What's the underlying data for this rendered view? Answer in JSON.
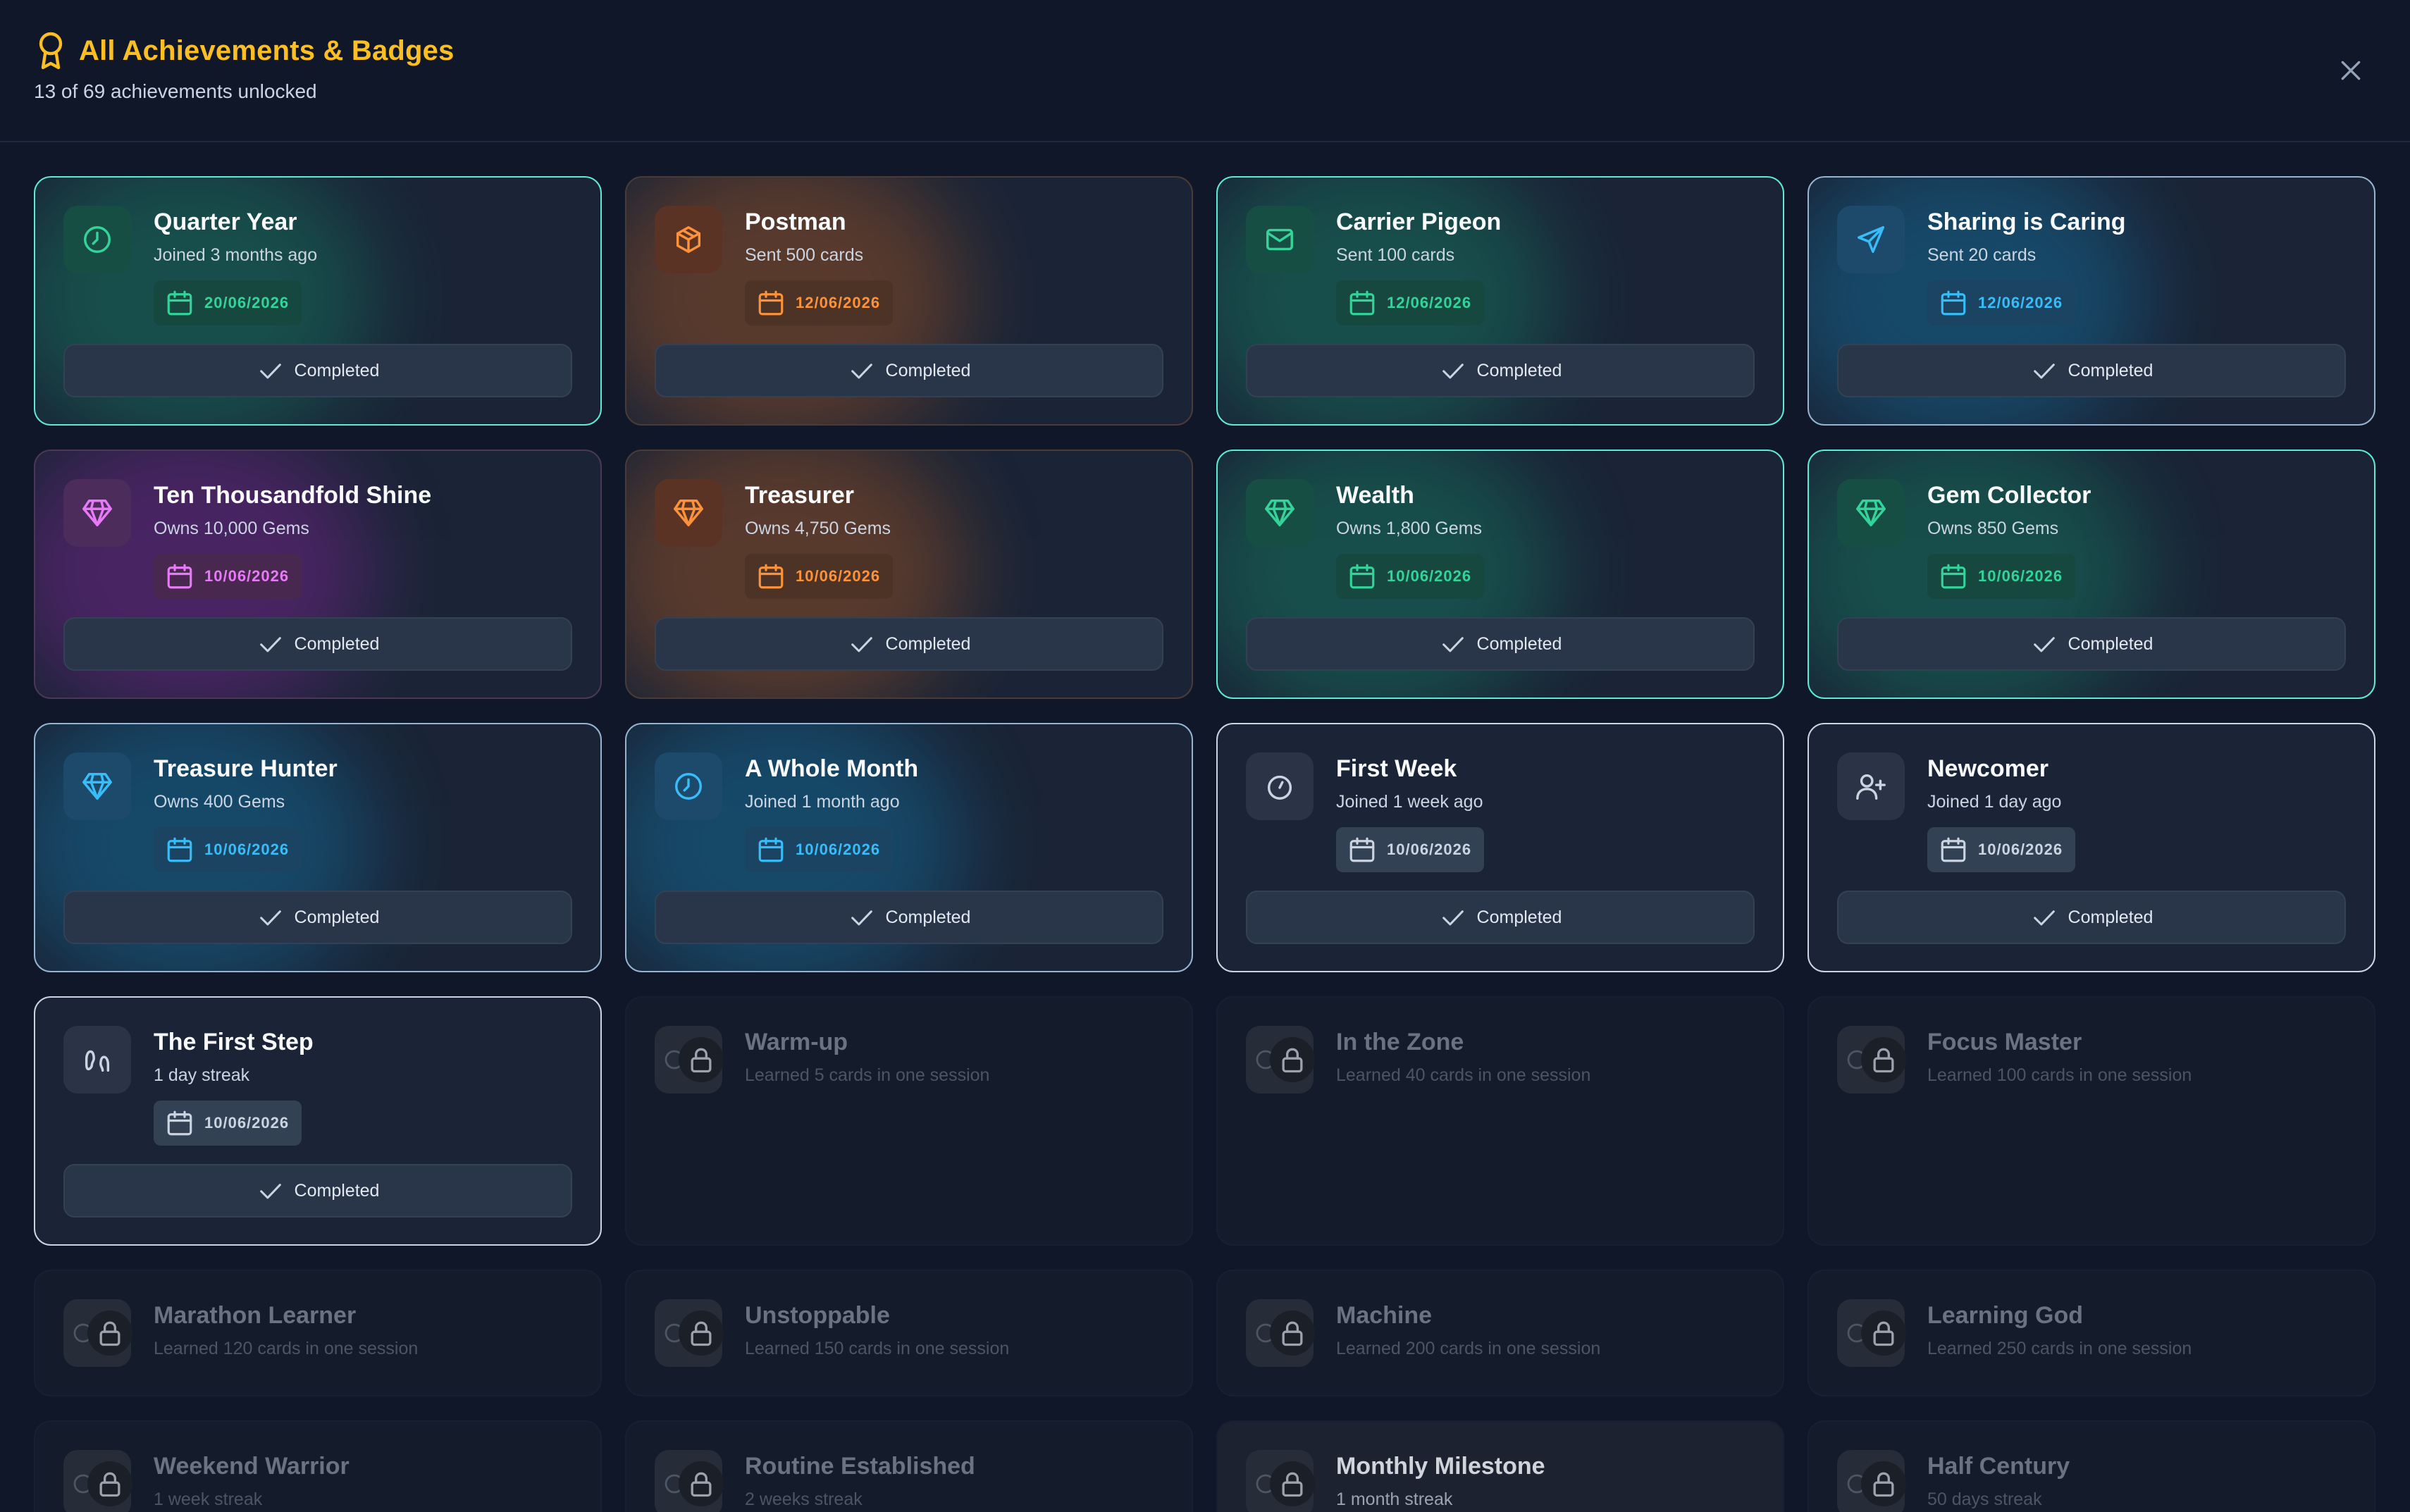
{
  "header": {
    "title": "All Achievements & Badges",
    "subtitle": "13 of 69 achievements unlocked",
    "title_icon": "award-icon",
    "close_icon": "close-icon"
  },
  "labels": {
    "completed": "Completed"
  },
  "colors": {
    "accent": "#fbbf24",
    "green": "#34d399",
    "orange": "#fb923c",
    "blue": "#38bdf8",
    "purple": "#e879f9",
    "gray": "#94a3b8"
  },
  "achievements": [
    {
      "name": "Quarter Year",
      "desc": "Joined 3 months ago",
      "date": "20/06/2026",
      "icon": "clock-icon",
      "color": "green"
    },
    {
      "name": "Postman",
      "desc": "Sent 500 cards",
      "date": "12/06/2026",
      "icon": "package-icon",
      "color": "orange"
    },
    {
      "name": "Carrier Pigeon",
      "desc": "Sent 100 cards",
      "date": "12/06/2026",
      "icon": "mail-icon",
      "color": "green"
    },
    {
      "name": "Sharing is Caring",
      "desc": "Sent 20 cards",
      "date": "12/06/2026",
      "icon": "send-icon",
      "color": "blue"
    },
    {
      "name": "Ten Thousandfold Shine",
      "desc": "Owns 10,000 Gems",
      "date": "10/06/2026",
      "icon": "gem-icon",
      "color": "purple"
    },
    {
      "name": "Treasurer",
      "desc": "Owns 4,750 Gems",
      "date": "10/06/2026",
      "icon": "gem-icon",
      "color": "orange"
    },
    {
      "name": "Wealth",
      "desc": "Owns 1,800 Gems",
      "date": "10/06/2026",
      "icon": "gem-icon",
      "color": "green"
    },
    {
      "name": "Gem Collector",
      "desc": "Owns 850 Gems",
      "date": "10/06/2026",
      "icon": "gem-icon",
      "color": "green"
    },
    {
      "name": "Treasure Hunter",
      "desc": "Owns 400 Gems",
      "date": "10/06/2026",
      "icon": "gem-icon",
      "color": "blue"
    },
    {
      "name": "A Whole Month",
      "desc": "Joined 1 month ago",
      "date": "10/06/2026",
      "icon": "clock-icon",
      "color": "blue"
    },
    {
      "name": "First Week",
      "desc": "Joined 1 week ago",
      "date": "10/06/2026",
      "icon": "timer-icon",
      "color": "gray"
    },
    {
      "name": "Newcomer",
      "desc": "Joined 1 day ago",
      "date": "10/06/2026",
      "icon": "user-plus-icon",
      "color": "gray"
    },
    {
      "name": "The First Step",
      "desc": "1 day streak",
      "date": "10/06/2026",
      "icon": "footprints-icon",
      "color": "gray"
    }
  ],
  "locked": [
    {
      "name": "Warm-up",
      "desc": "Learned 5 cards in one session"
    },
    {
      "name": "In the Zone",
      "desc": "Learned 40 cards in one session"
    },
    {
      "name": "Focus Master",
      "desc": "Learned 100 cards in one session"
    },
    {
      "name": "Marathon Learner",
      "desc": "Learned 120 cards in one session"
    },
    {
      "name": "Unstoppable",
      "desc": "Learned 150 cards in one session"
    },
    {
      "name": "Machine",
      "desc": "Learned 200 cards in one session"
    },
    {
      "name": "Learning God",
      "desc": "Learned 250 cards in one session"
    },
    {
      "name": "Weekend Warrior",
      "desc": "1 week streak"
    },
    {
      "name": "Routine Established",
      "desc": "2 weeks streak"
    },
    {
      "name": "Monthly Milestone",
      "desc": "1 month streak"
    },
    {
      "name": "Half Century",
      "desc": "50 days streak"
    }
  ]
}
